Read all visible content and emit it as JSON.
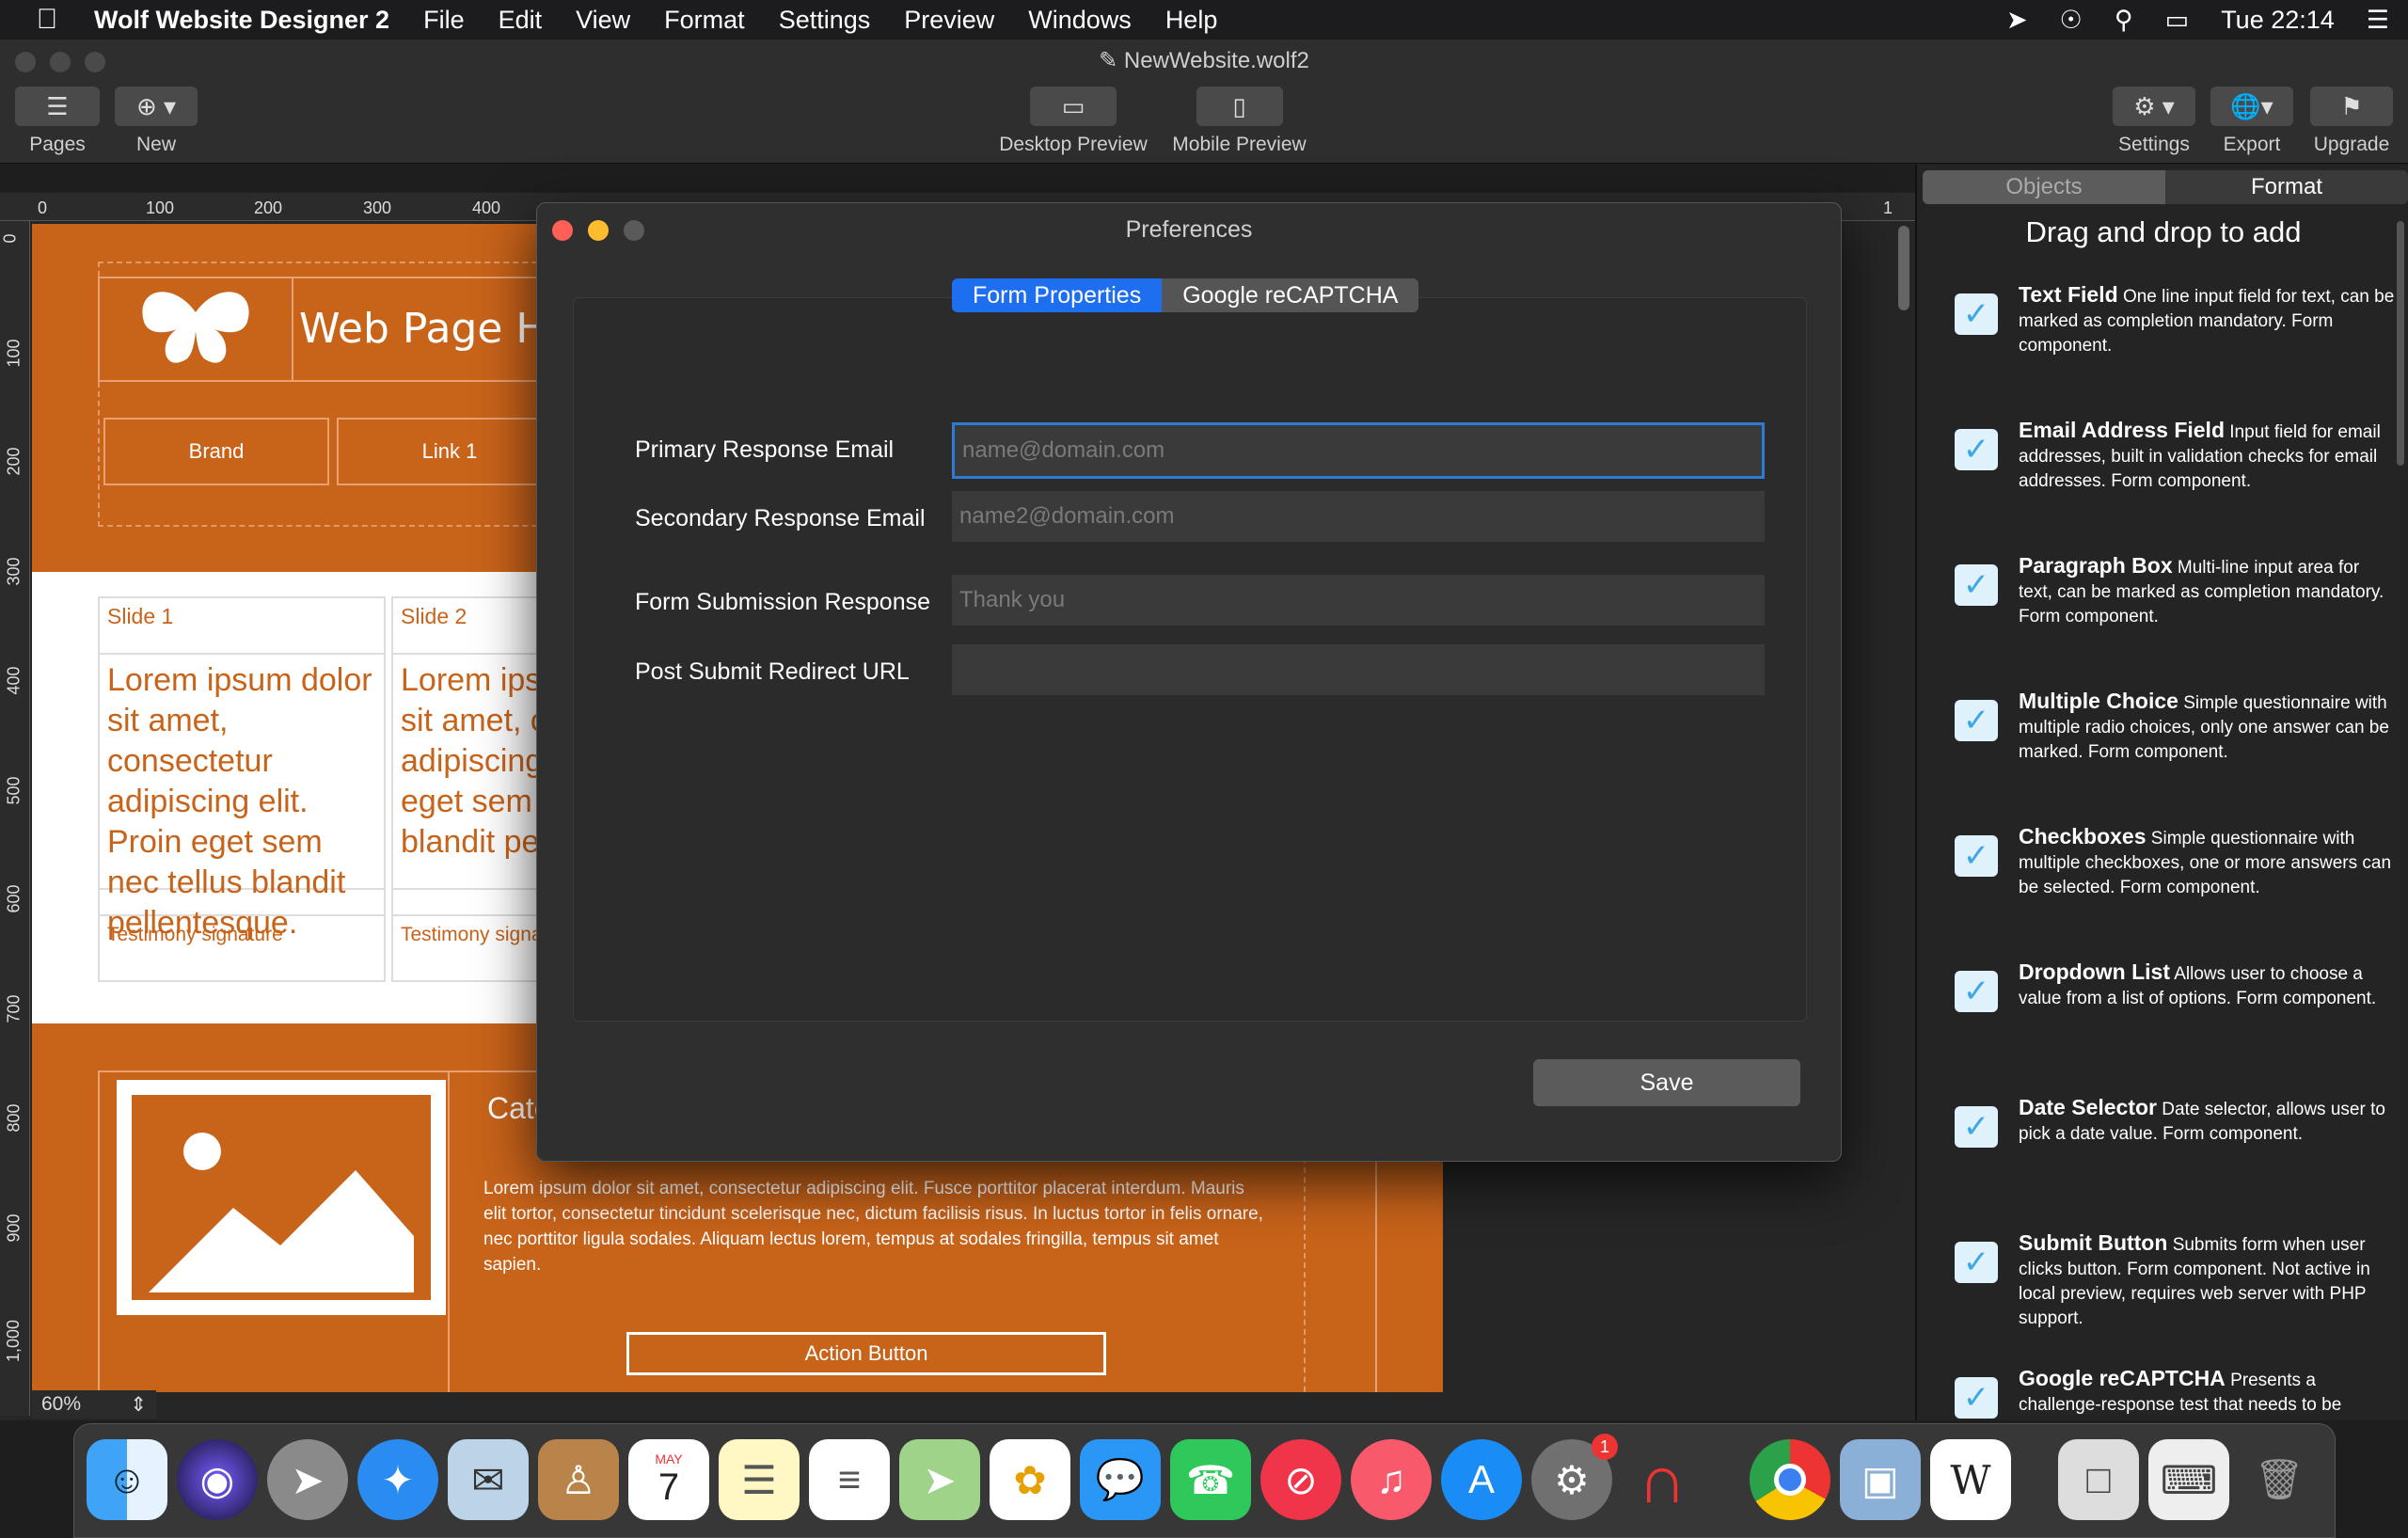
{
  "menubar": {
    "app_name": "Wolf Website Designer 2",
    "items": [
      "File",
      "Edit",
      "View",
      "Format",
      "Settings",
      "Preview",
      "Windows",
      "Help"
    ],
    "clock": "Tue 22:14"
  },
  "window": {
    "title": "NewWebsite.wolf2",
    "toolbar": {
      "pages": "Pages",
      "new": "New",
      "desktop_preview": "Desktop Preview",
      "mobile_preview": "Mobile Preview",
      "settings": "Settings",
      "export": "Export",
      "upgrade": "Upgrade"
    }
  },
  "ruler": {
    "top": [
      "0",
      "100",
      "200",
      "300",
      "400"
    ],
    "top_right": "1",
    "left": [
      "0",
      "100",
      "200",
      "300",
      "400",
      "500",
      "600",
      "700",
      "800",
      "900",
      "1,000"
    ]
  },
  "canvas": {
    "header_title": "Web Page He",
    "nav": [
      "Brand",
      "Link 1"
    ],
    "slides": [
      {
        "title": "Slide 1",
        "text": "Lorem ipsum dolor sit amet, consectetur adipiscing elit. Proin eget sem nec tellus blandit pellentesque.",
        "signature": "Testimony signature"
      },
      {
        "title": "Slide 2",
        "text": "Lorem ipsu sit amet, co adipiscing eget sem n blandit pel",
        "signature": "Testimony signa"
      }
    ],
    "category_title": "Cate",
    "body_text": "Lorem ipsum dolor sit amet, consectetur adipiscing elit. Fusce porttitor placerat interdum. Mauris elit tortor, consectetur tincidunt scelerisque nec, dictum facilisis risus. In luctus tortor in felis ornare, nec porttitor ligula sodales. Aliquam lectus lorem, tempus at sodales fringilla, tempus sit amet sapien.",
    "action_button": "Action Button",
    "zoom": "60%"
  },
  "dialog": {
    "title": "Preferences",
    "tabs": [
      "Form Properties",
      "Google reCAPTCHA"
    ],
    "active_tab": "Form Properties",
    "fields": [
      {
        "label": "Primary Response Email",
        "placeholder": "name@domain.com",
        "value": ""
      },
      {
        "label": "Secondary Response Email",
        "placeholder": "name2@domain.com",
        "value": ""
      },
      {
        "label": "Form Submission Response",
        "placeholder": "Thank you",
        "value": ""
      },
      {
        "label": "Post Submit Redirect URL",
        "placeholder": "",
        "value": ""
      }
    ],
    "save": "Save"
  },
  "panel": {
    "tabs": [
      "Objects",
      "Format"
    ],
    "active_tab": "Format",
    "heading": "Drag and drop to add",
    "items": [
      {
        "name": "Text Field",
        "desc": "One line input field for text, can be marked as completion mandatory. Form component."
      },
      {
        "name": "Email Address Field",
        "desc": "Input field for email addresses, built in validation checks for email addresses.  Form component."
      },
      {
        "name": "Paragraph Box",
        "desc": "Multi-line input area for text, can be marked as completion mandatory.  Form component."
      },
      {
        "name": "Multiple Choice",
        "desc": "Simple questionnaire with multiple radio choices, only one answer can be marked.  Form component."
      },
      {
        "name": "Checkboxes",
        "desc": "Simple questionnaire with multiple checkboxes, one or more answers can be selected.  Form component."
      },
      {
        "name": "Dropdown List",
        "desc": "Allows user to choose a value from a list of options.  Form component."
      },
      {
        "name": "Date Selector",
        "desc": "Date selector, allows user to pick a date value.  Form component."
      },
      {
        "name": "Submit Button",
        "desc": "Submits form when user clicks button.  Form component.  Not active in local preview, requires web server with PHP support."
      },
      {
        "name": "Google reCAPTCHA",
        "desc": "Presents a challenge-response test that needs to be"
      }
    ]
  },
  "dock": {
    "icons": [
      "finder-icon",
      "siri-icon",
      "launchpad-icon",
      "safari-icon",
      "mail-icon",
      "contacts-icon",
      "calendar-icon",
      "notes-icon",
      "reminders-icon",
      "maps-icon",
      "photos-icon",
      "messages-icon",
      "facetime-icon",
      "news-icon",
      "music-icon",
      "app-store-icon",
      "system-preferences-icon",
      "magnet-icon",
      "chrome-icon",
      "preview-icon",
      "wolf-icon",
      "document-icon",
      "keyboard-icon",
      "trash-icon"
    ],
    "calendar_month": "MAY",
    "calendar_day": "7",
    "badge": "1"
  }
}
